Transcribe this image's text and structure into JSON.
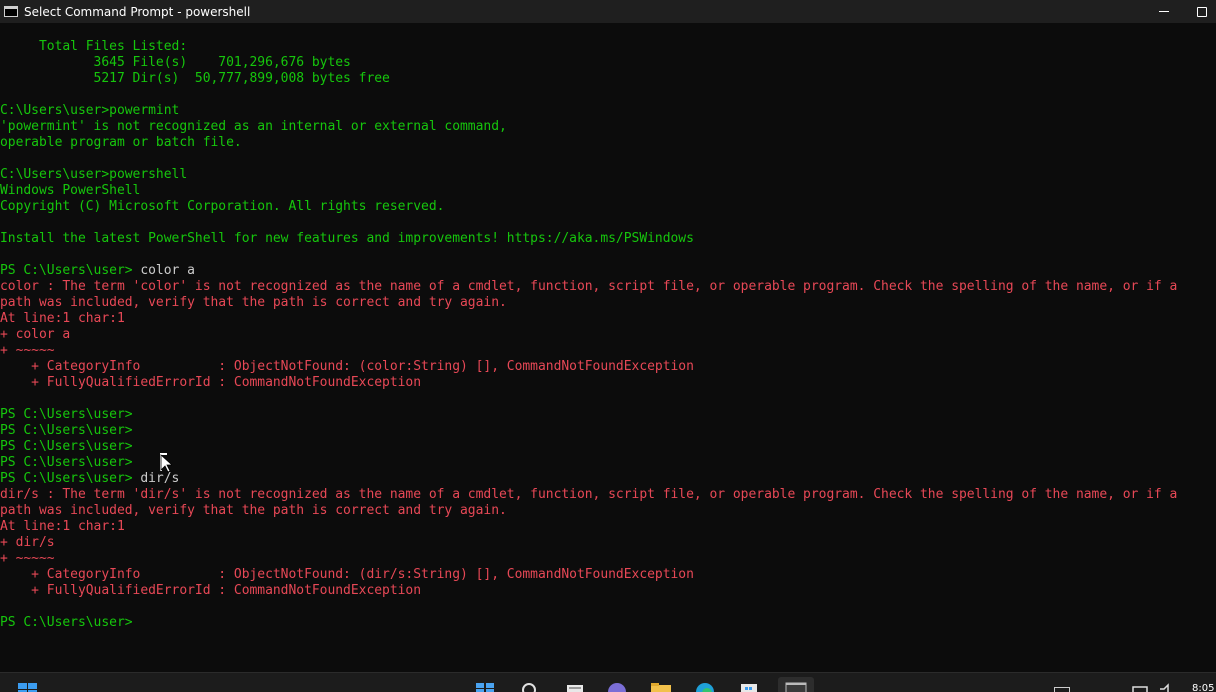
{
  "window": {
    "title": "Select Command Prompt - powershell"
  },
  "console": {
    "lines": [
      {
        "t": "     Total Files Listed:",
        "c": "g"
      },
      {
        "t": "            3645 File(s)    701,296,676 bytes",
        "c": "g"
      },
      {
        "t": "            5217 Dir(s)  50,777,899,008 bytes free",
        "c": "g"
      },
      {
        "t": "",
        "c": "g"
      },
      {
        "t": "C:\\Users\\user>powermint",
        "c": "g"
      },
      {
        "t": "'powermint' is not recognized as an internal or external command,",
        "c": "g"
      },
      {
        "t": "operable program or batch file.",
        "c": "g"
      },
      {
        "t": "",
        "c": "g"
      },
      {
        "t": "C:\\Users\\user>powershell",
        "c": "g"
      },
      {
        "t": "Windows PowerShell",
        "c": "g"
      },
      {
        "t": "Copyright (C) Microsoft Corporation. All rights reserved.",
        "c": "g"
      },
      {
        "t": "",
        "c": "g"
      },
      {
        "t": "Install the latest PowerShell for new features and improvements! https://aka.ms/PSWindows",
        "c": "g"
      },
      {
        "t": "",
        "c": "g"
      },
      {
        "t": "PS C:\\Users\\user> ",
        "c": "g",
        "cmd": "color a"
      },
      {
        "t": "color : The term 'color' is not recognized as the name of a cmdlet, function, script file, or operable program. Check the spelling of the name, or if a",
        "c": "r"
      },
      {
        "t": "path was included, verify that the path is correct and try again.",
        "c": "r"
      },
      {
        "t": "At line:1 char:1",
        "c": "r"
      },
      {
        "t": "+ color a",
        "c": "r"
      },
      {
        "t": "+ ~~~~~",
        "c": "r"
      },
      {
        "t": "    + CategoryInfo          : ObjectNotFound: (color:String) [], CommandNotFoundException",
        "c": "r"
      },
      {
        "t": "    + FullyQualifiedErrorId : CommandNotFoundException",
        "c": "r"
      },
      {
        "t": "",
        "c": "g"
      },
      {
        "t": "PS C:\\Users\\user>",
        "c": "g"
      },
      {
        "t": "PS C:\\Users\\user>",
        "c": "g"
      },
      {
        "t": "PS C:\\Users\\user>",
        "c": "g"
      },
      {
        "t": "PS C:\\Users\\user>",
        "c": "g"
      },
      {
        "t": "PS C:\\Users\\user> ",
        "c": "g",
        "cmd": "dir/s"
      },
      {
        "t": "dir/s : The term 'dir/s' is not recognized as the name of a cmdlet, function, script file, or operable program. Check the spelling of the name, or if a",
        "c": "r"
      },
      {
        "t": "path was included, verify that the path is correct and try again.",
        "c": "r"
      },
      {
        "t": "At line:1 char:1",
        "c": "r"
      },
      {
        "t": "+ dir/s",
        "c": "r"
      },
      {
        "t": "+ ~~~~~",
        "c": "r"
      },
      {
        "t": "    + CategoryInfo          : ObjectNotFound: (dir/s:String) [], CommandNotFoundException",
        "c": "r"
      },
      {
        "t": "    + FullyQualifiedErrorId : CommandNotFoundException",
        "c": "r"
      },
      {
        "t": "",
        "c": "g"
      },
      {
        "t": "PS C:\\Users\\user>",
        "c": "g"
      }
    ]
  },
  "taskbar": {
    "clock": "8:05",
    "icons": [
      "windows-start-icon",
      "task-view-icon",
      "search-icon",
      "widgets-icon",
      "chat-icon",
      "file-explorer-icon",
      "edge-icon",
      "store-icon",
      "terminal-icon"
    ]
  },
  "colors": {
    "console_bg": "#0c0c0c",
    "green": "#16c60c",
    "red": "#e74856",
    "white": "#cccccc",
    "titlebar_bg": "#1f1f1f"
  }
}
